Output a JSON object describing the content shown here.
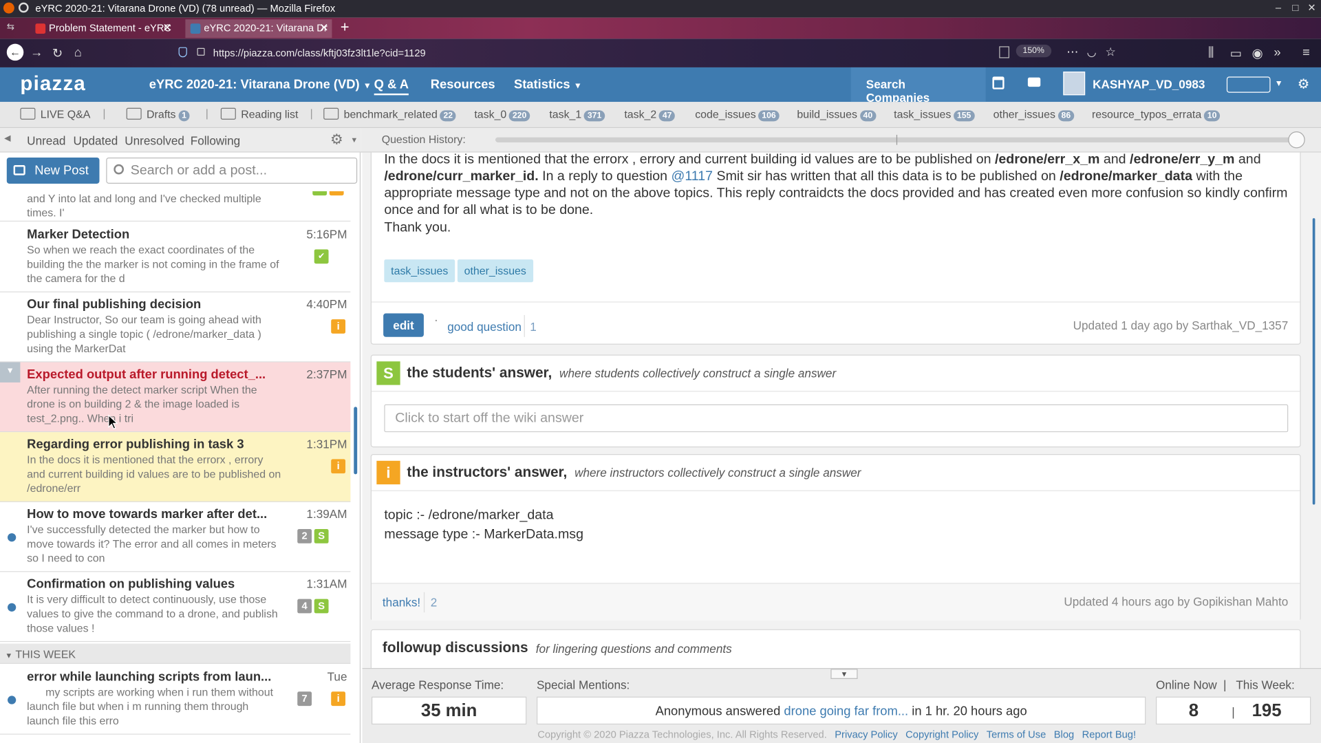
{
  "browser": {
    "window_title": "eYRC 2020-21: Vitarana Drone (VD) (78 unread) — Mozilla Firefox",
    "tabs": [
      {
        "label": "Problem Statement - eYRC",
        "active": false
      },
      {
        "label": "eYRC 2020-21: Vitarana Dr",
        "active": true
      }
    ],
    "url": "https://piazza.com/class/kftj03fz3lt1le?cid=1129",
    "zoom": "150%"
  },
  "header": {
    "logo": "piazza",
    "class_name": "eYRC 2020-21: Vitarana Drone (VD)",
    "nav": [
      "Q & A",
      "Resources",
      "Statistics"
    ],
    "search_companies": "Search Companies",
    "username": "KASHYAP_VD_0983"
  },
  "folders": [
    {
      "label": "LIVE Q&A",
      "count": ""
    },
    {
      "label": "Drafts",
      "count": "1"
    },
    {
      "label": "Reading list",
      "count": ""
    },
    {
      "label": "benchmark_related",
      "count": "22"
    },
    {
      "label": "task_0",
      "count": "220"
    },
    {
      "label": "task_1",
      "count": "371"
    },
    {
      "label": "task_2",
      "count": "47"
    },
    {
      "label": "code_issues",
      "count": "106"
    },
    {
      "label": "build_issues",
      "count": "40"
    },
    {
      "label": "task_issues",
      "count": "155"
    },
    {
      "label": "other_issues",
      "count": "86"
    },
    {
      "label": "resource_typos_errata",
      "count": "10"
    }
  ],
  "filters": [
    "Unread",
    "Updated",
    "Unresolved",
    "Following"
  ],
  "question_history_label": "Question History:",
  "left": {
    "new_post": "New Post",
    "search_placeholder": "Search or add a post...",
    "partial_snippet": "and Y into lat and long and I've checked multiple times. I'",
    "posts": [
      {
        "title": "Marker Detection",
        "snippet": "So when we reach the exact coordinates of the building the the marker is not coming in the frame of the camera for the d",
        "time": "5:16PM"
      },
      {
        "title": "Our final publishing decision",
        "snippet": "Dear Instructor, So our team is going ahead with publishing a single topic ( /edrone/marker_data ) using the MarkerDat",
        "time": "4:40PM"
      },
      {
        "title": "Expected output after running detect_...",
        "snippet": "After running the detect marker script When the drone is on building 2 & the image loaded is test_2.png.. When i tri",
        "time": "2:37PM"
      },
      {
        "title": "Regarding error publishing in task 3",
        "snippet": "In the docs it is mentioned that the errorx , errory and current building id values are to be published on /edrone/err",
        "time": "1:31PM"
      },
      {
        "title": "How to move towards marker after det...",
        "snippet": "I've successfully detected the marker but how to move towards it? The error and all comes in meters so I need to con",
        "time": "1:39AM",
        "count": "2"
      },
      {
        "title": "Confirmation on publishing values",
        "snippet": "It is very difficult to detect continuously, use those values to give the command to a drone, and publish those values !",
        "time": "1:31AM",
        "count": "4"
      },
      {
        "title": "error while launching scripts from laun...",
        "snippet": "my scripts are working when i run them without launch file but when i m running them through launch file this erro",
        "time": "Tue",
        "count": "7"
      }
    ],
    "section_this_week": "THIS WEEK"
  },
  "question": {
    "body_line1_pre": "In the docs it is mentioned that the errorx , errory and current building id values are to be published on ",
    "topic_x": "/edrone/err_x_m",
    "and1": " and ",
    "topic_y": "/edrone/err_y_m",
    "and2": " and",
    "topic_id": "/edrone/curr_marker_id.",
    "body_mid1": " In a reply to question ",
    "ref": "@1117",
    "body_mid2": " Smit sir has written that all this data is to be published on ",
    "topic_data": "/edrone/marker_data",
    "body_end": " with the appropriate message type and not on the above topics. This reply contraidcts the docs provided and has created even more confusion so kindly confirm once and for all what is to be done.",
    "thanks": "Thank you.",
    "tags": [
      "task_issues",
      "other_issues"
    ],
    "edit": "edit",
    "good_question": "good question",
    "good_count": "1",
    "updated": "Updated 1 day ago by Sarthak_VD_1357"
  },
  "students_answer": {
    "title": "the students' answer,",
    "subtitle": "where students collectively construct a single answer",
    "placeholder": "Click to start off the wiki answer"
  },
  "instructors_answer": {
    "title": "the instructors' answer,",
    "subtitle": "where instructors collectively construct a single answer",
    "line1": "topic :- /edrone/marker_data",
    "line2": "message type :- MarkerData.msg",
    "thanks": "thanks!",
    "thanks_count": "2",
    "updated": "Updated 4 hours ago by Gopikishan Mahto"
  },
  "followup": {
    "title": "followup discussions",
    "subtitle": "for lingering questions and comments"
  },
  "footer": {
    "avg_label": "Average Response Time:",
    "avg_value": "35 min",
    "mentions_label": "Special Mentions:",
    "mention_pre": "Anonymous answered ",
    "mention_link": "drone going far from...",
    "mention_post": " in 1 hr. 20 hours ago",
    "online_label": "Online Now",
    "week_label": "This Week:",
    "online_value": "8",
    "week_value": "195",
    "copyright": "Copyright © 2020 Piazza Technologies, Inc. All Rights Reserved.",
    "links": [
      "Privacy Policy",
      "Copyright Policy",
      "Terms of Use",
      "Blog",
      "Report Bug!"
    ]
  },
  "colors": {
    "piazza_blue": "#3e7bb0",
    "note_orange": "#f5a623",
    "student_green": "#8dc63f",
    "unread_red": "#b9192a"
  }
}
